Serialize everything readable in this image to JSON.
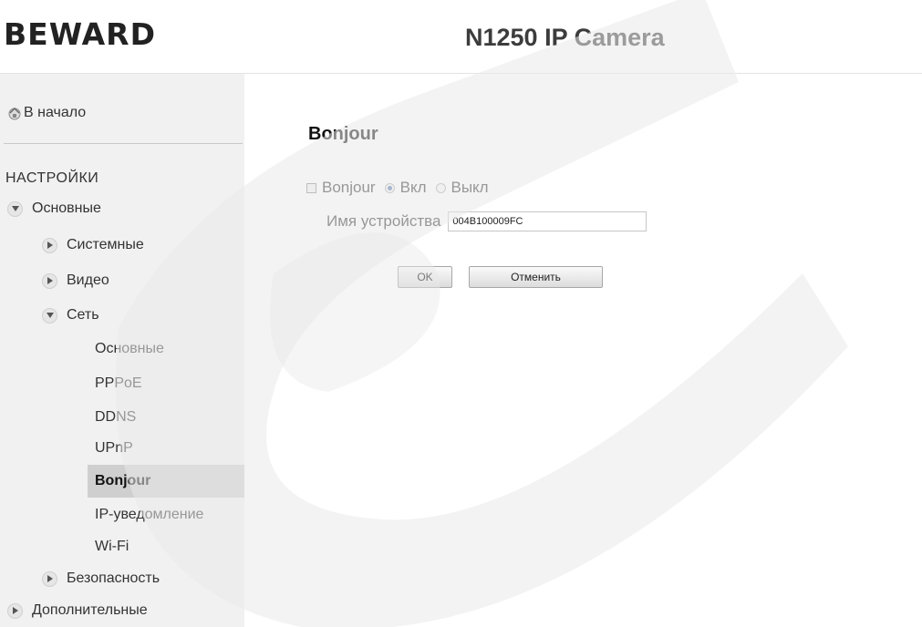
{
  "header": {
    "logo_text": "BEWARD",
    "camera_title": "N1250 IP Camera"
  },
  "sidebar": {
    "home_label": "В начало",
    "home_icon": "home-icon",
    "section_title": "НАСТРОЙКИ",
    "items": {
      "basic": "Основные",
      "system": "Системные",
      "video": "Видео",
      "network": "Сеть",
      "network_basic": "Основные",
      "pppoe": "PPPoE",
      "ddns": "DDNS",
      "upnp": "UPnP",
      "bonjour": "Bonjour",
      "ip_notify": "IP-уведомление",
      "wifi": "Wi-Fi",
      "security": "Безопасность",
      "advanced": "Дополнительные"
    },
    "selected_item": "Bonjour",
    "selected_bg": "#cfcfcf",
    "bg": "#f1f1f1"
  },
  "main": {
    "title": "Bonjour",
    "option_label": "Bonjour",
    "on_label": "Вкл",
    "off_label": "Выкл",
    "selected_option": "Вкл",
    "device_name_label": "Имя устройства",
    "device_name_value": "004B100009FC",
    "ok_label": "OK",
    "cancel_label": "Отменить"
  },
  "watermark": {
    "color": "#e9e9e9"
  }
}
